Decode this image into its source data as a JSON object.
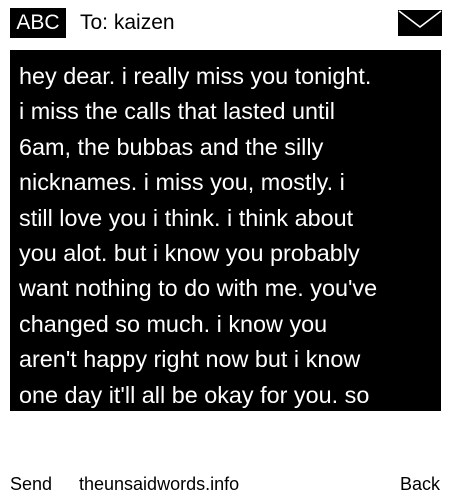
{
  "header": {
    "input_mode": "ABC",
    "recipient": "To: kaizen",
    "icon": "envelope-icon"
  },
  "message": {
    "lines": [
      "hey dear. i really miss you tonight.",
      "i miss the calls that lasted until",
      "6am, the bubbas and the silly",
      "nicknames. i miss you, mostly. i",
      "still love you i think. i think about",
      "you alot. but i know you probably",
      "want nothing to do with me. you've",
      "changed so much. i know you",
      "aren't happy right now but i know",
      "one day it'll all be okay for you. so"
    ]
  },
  "footer": {
    "send_label": "Send",
    "site": "theunsaidwords.info",
    "back_label": "Back"
  },
  "colors": {
    "background": "#ffffff",
    "panel": "#000000",
    "text_inverse": "#ffffff"
  }
}
